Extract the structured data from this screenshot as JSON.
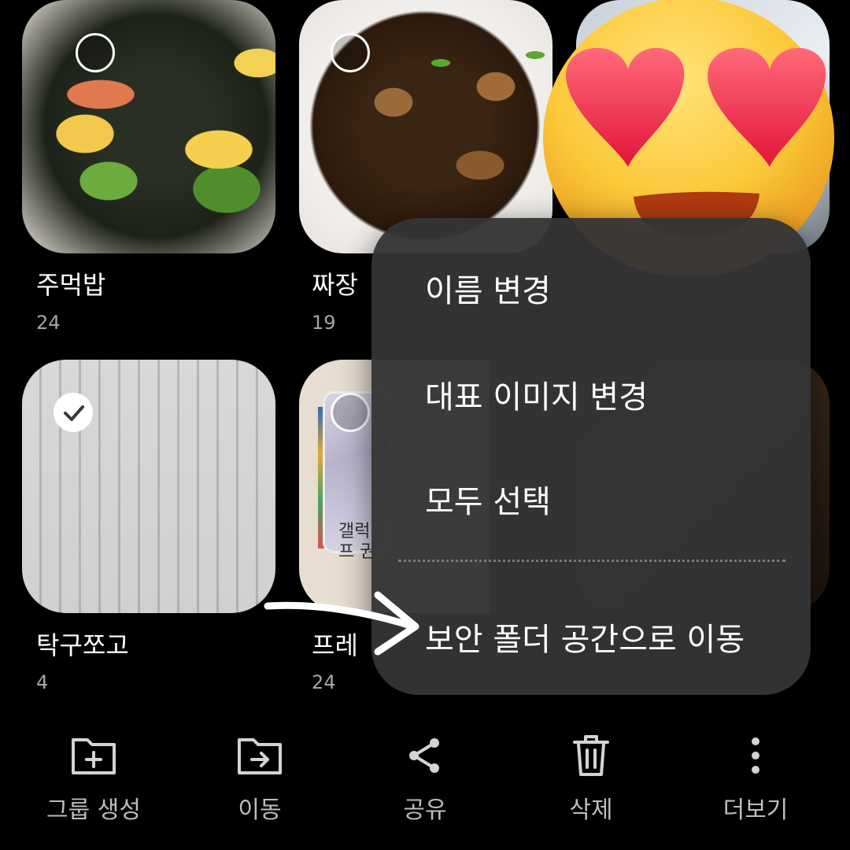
{
  "albums": [
    {
      "name": "주먹밥",
      "count": "24",
      "selected": false
    },
    {
      "name": "짜장밥",
      "count": "19",
      "selected": false
    },
    {
      "name": "",
      "count": "",
      "selected": false
    },
    {
      "name": "탁구쪼고",
      "count": "4",
      "selected": true
    },
    {
      "name": "프레임",
      "count": "24",
      "selected": false
    },
    {
      "name": "",
      "count": "",
      "selected": false
    }
  ],
  "album_visible_names": [
    "주먹밥",
    "짜장",
    "탁구쪼고",
    "프레"
  ],
  "doc_text": "갤럭 프 권",
  "menu": {
    "items": [
      "이름 변경",
      "대표 이미지 변경",
      "모두 선택",
      "보안 폴더 공간으로 이동"
    ]
  },
  "bottom_bar": {
    "items": [
      {
        "label": "그룹 생성",
        "icon": "folder-plus-icon"
      },
      {
        "label": "이동",
        "icon": "folder-move-icon"
      },
      {
        "label": "공유",
        "icon": "share-icon"
      },
      {
        "label": "삭제",
        "icon": "trash-icon"
      },
      {
        "label": "더보기",
        "icon": "more-vertical-icon"
      }
    ]
  },
  "colors": {
    "background": "#000000",
    "menu_bg": "#343436",
    "text_primary": "#ffffff",
    "text_secondary": "#a6a6a6"
  }
}
